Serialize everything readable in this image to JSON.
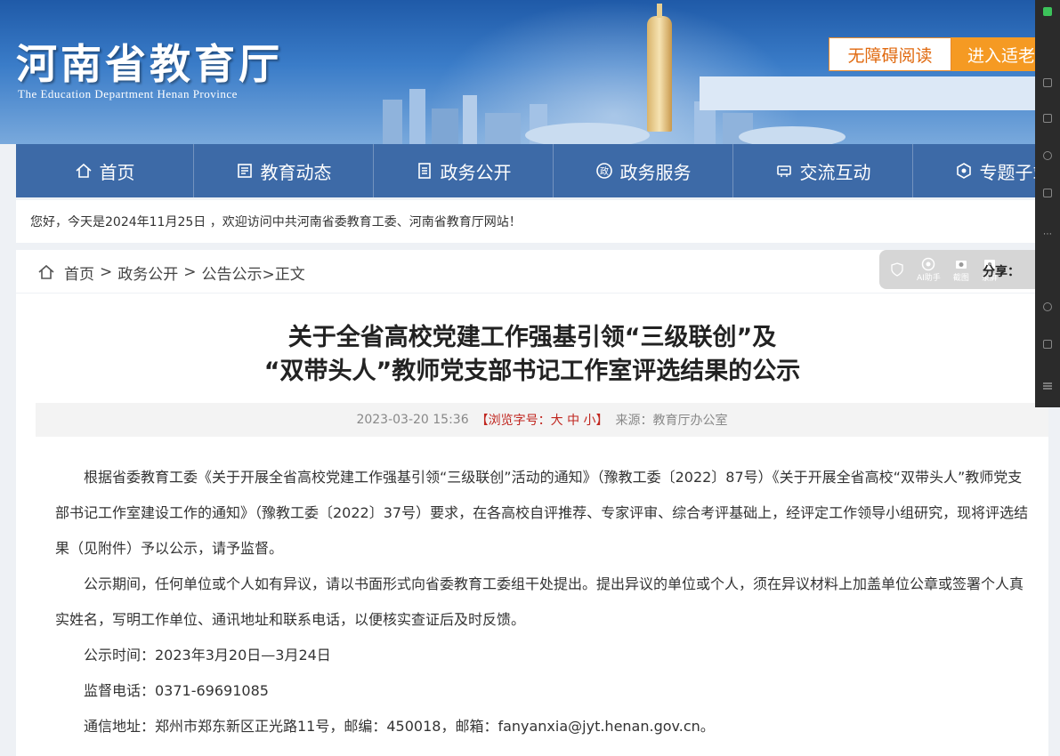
{
  "header": {
    "logo_cn": "河南省教育厅",
    "logo_en": "The Education Department Henan Province",
    "accessibility_label": "无障碍阅读",
    "elder_mode_label": "进入适老"
  },
  "nav": [
    {
      "label": "首页",
      "icon": "home-icon"
    },
    {
      "label": "教育动态",
      "icon": "news-icon"
    },
    {
      "label": "政务公开",
      "icon": "document-icon"
    },
    {
      "label": "政务服务",
      "icon": "service-icon"
    },
    {
      "label": "交流互动",
      "icon": "chat-icon"
    },
    {
      "label": "专题子站",
      "icon": "topic-icon"
    }
  ],
  "welcome": "您好，今天是2024年11月25日 ，欢迎访问中共河南省委教育工委、河南省教育厅网站！",
  "breadcrumb": {
    "home": "首页",
    "sep": ">",
    "level1": "政务公开",
    "level2": "公告公示",
    "current": ">正文"
  },
  "toolbar": {
    "ai": "AI助手",
    "screenshot": "截图",
    "record": "录屏",
    "share_label": "分享："
  },
  "article": {
    "title_line1": "关于全省高校党建工作强基引领“三级联创”及",
    "title_line2": "“双带头人”教师党支部书记工作室评选结果的公示",
    "date": "2023-03-20 15:36",
    "font_size_label": "【浏览字号：大 中 小】",
    "source": "来源：教育厅办公室",
    "paragraphs": [
      "根据省委教育工委《关于开展全省高校党建工作强基引领“三级联创”活动的通知》（豫教工委〔2022〕87号）《关于开展全省高校“双带头人”教师党支部书记工作室建设工作的通知》（豫教工委〔2022〕37号）要求，在各高校自评推荐、专家评审、综合考评基础上，经评定工作领导小组研究，现将评选结果（见附件）予以公示，请予监督。",
      "公示期间，任何单位或个人如有异议，请以书面形式向省委教育工委组干处提出。提出异议的单位或个人，须在异议材料上加盖单位公章或签署个人真实姓名，写明工作单位、通讯地址和联系电话，以便核实查证后及时反馈。",
      "公示时间：2023年3月20日—3月24日",
      "监督电话：0371-69691085",
      "通信地址：郑州市郑东新区正光路11号，邮编：450018，邮箱：fanyanxia@jyt.henan.gov.cn。"
    ]
  }
}
